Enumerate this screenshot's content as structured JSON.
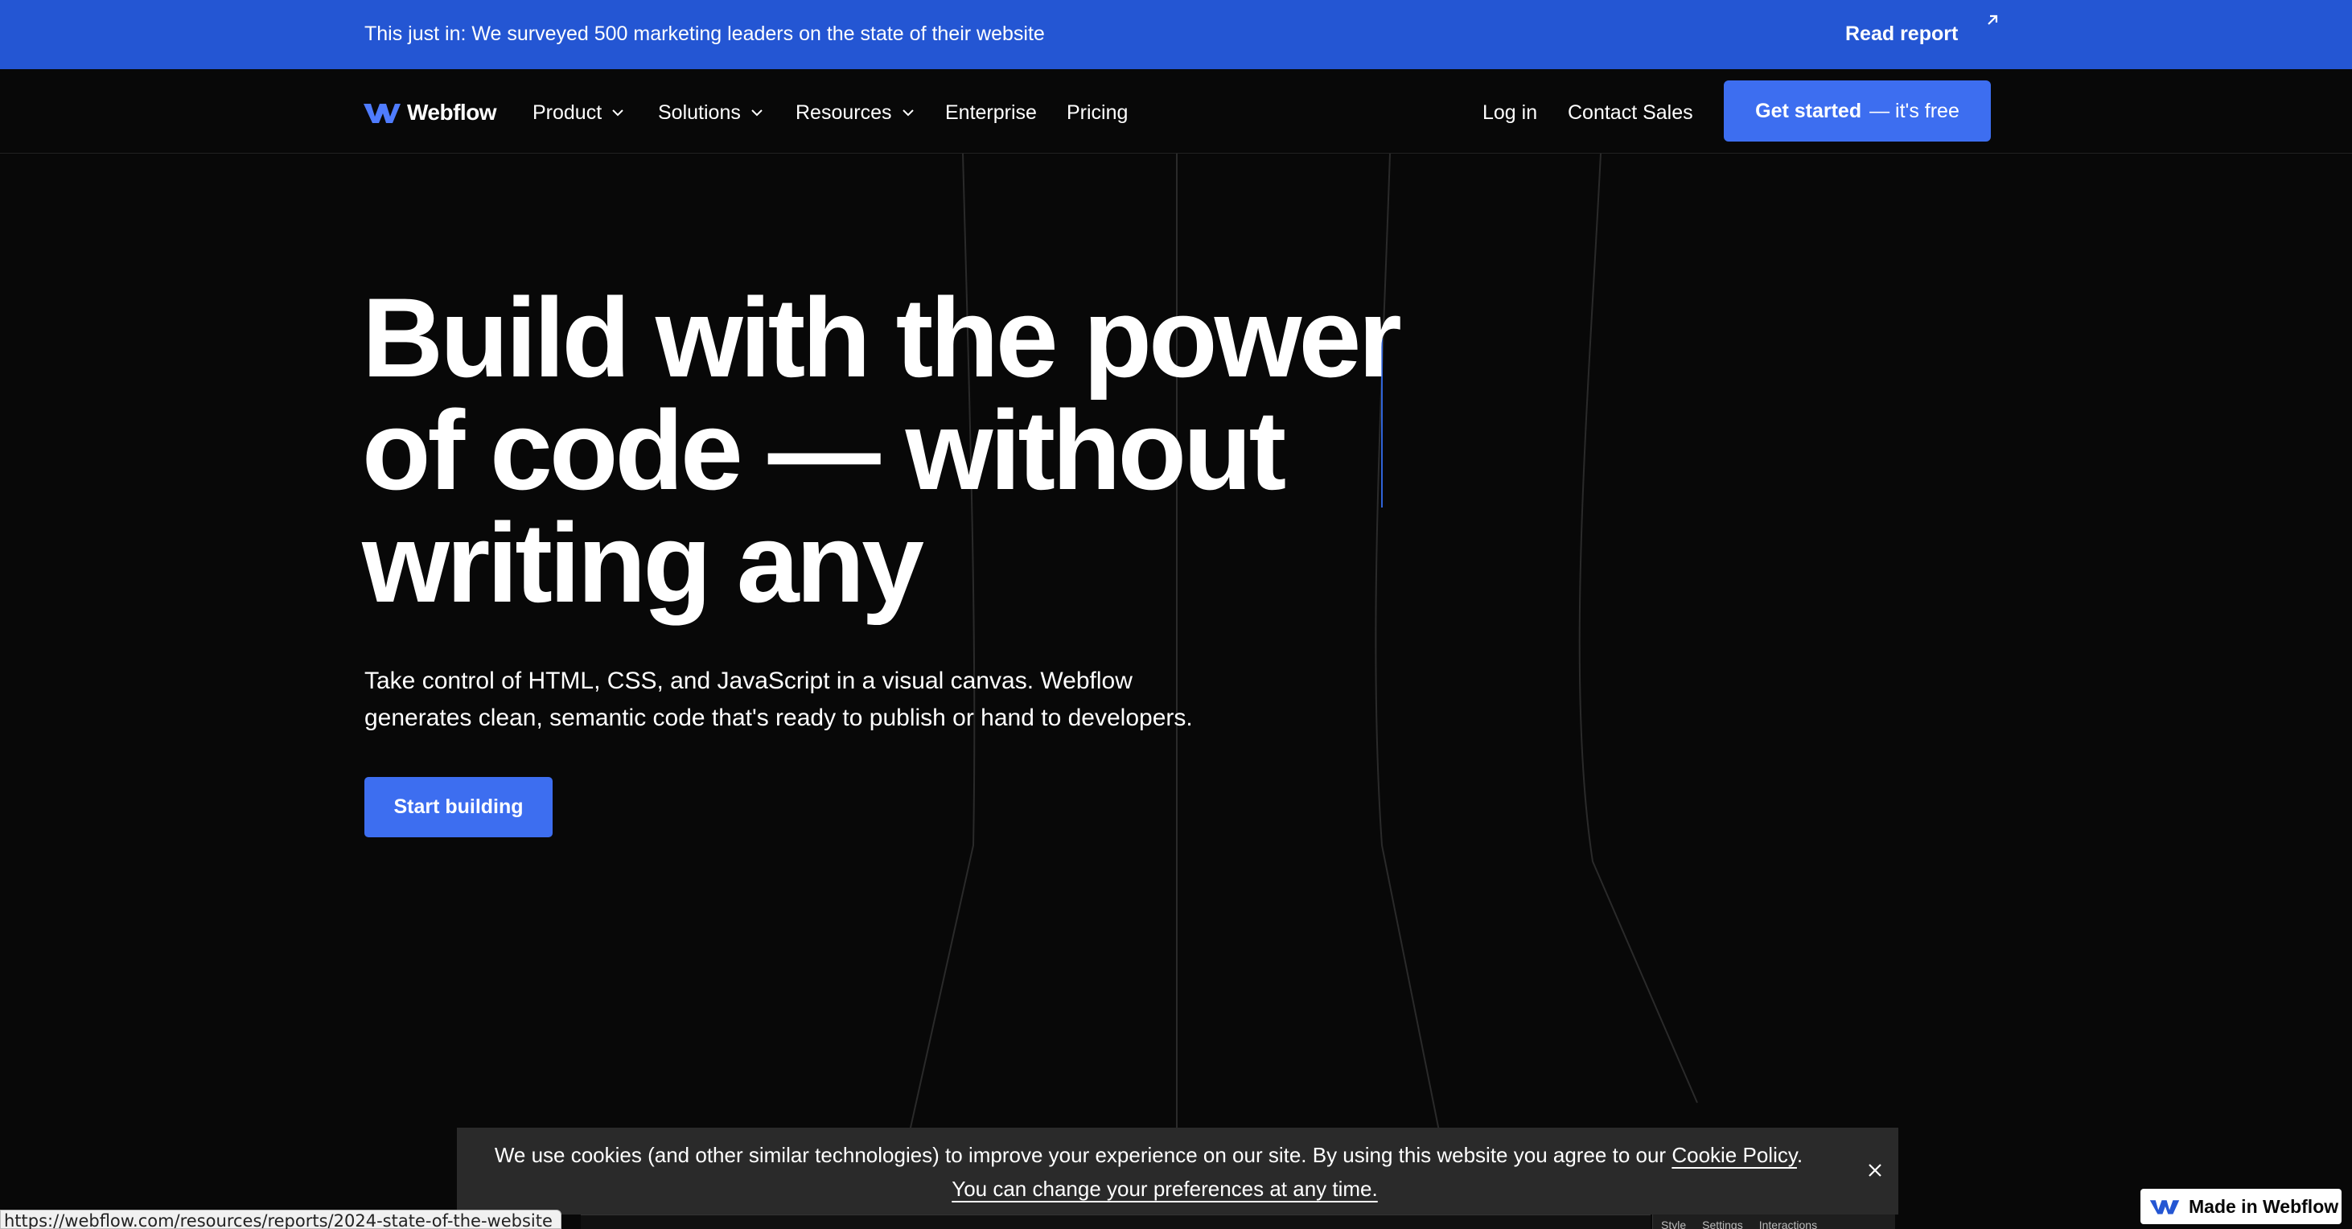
{
  "colors": {
    "banner_bg": "#2456d3",
    "accent": "#3d6ef0",
    "background": "#080808"
  },
  "banner": {
    "text": "This just in: We surveyed 500 marketing leaders on the state of their website",
    "link_label": "Read report",
    "link_icon": "arrow-up-right-icon"
  },
  "nav": {
    "logo_text": "Webflow",
    "items": [
      {
        "label": "Product",
        "has_dropdown": true
      },
      {
        "label": "Solutions",
        "has_dropdown": true
      },
      {
        "label": "Resources",
        "has_dropdown": true
      },
      {
        "label": "Enterprise",
        "has_dropdown": false
      },
      {
        "label": "Pricing",
        "has_dropdown": false
      }
    ],
    "login_label": "Log in",
    "contact_label": "Contact Sales",
    "cta_strong": "Get started",
    "cta_light": "— it's free"
  },
  "hero": {
    "title_lines": [
      "Build with the power",
      "of code — without",
      "writing any"
    ],
    "subtitle_line1": "Take control of HTML, CSS, and JavaScript in a visual canvas. Webflow",
    "subtitle_line2": "generates clean, semantic code that's ready to publish or hand to developers.",
    "button_label": "Start building"
  },
  "cookie": {
    "text_before": "We use cookies (and other similar technologies) to improve your experience on our site. By using this website you agree to our ",
    "policy_link": "Cookie Policy",
    "text_after": ".",
    "preferences_link": "You can change your preferences at any time."
  },
  "preview": {
    "tabs": [
      "Style",
      "Settings",
      "Interactions"
    ]
  },
  "status_url": "https://webflow.com/resources/reports/2024-state-of-the-website",
  "badge": {
    "label": "Made in Webflow"
  }
}
